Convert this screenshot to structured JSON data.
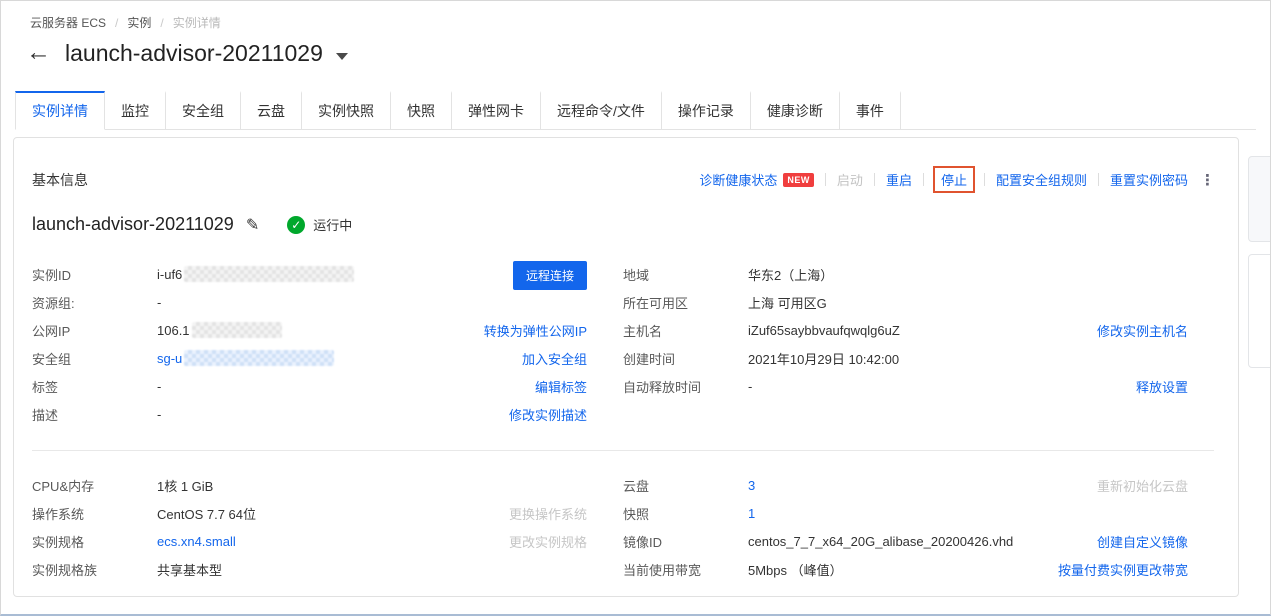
{
  "breadcrumb": {
    "items": [
      "云服务器 ECS",
      "实例",
      "实例详情"
    ],
    "separator": "/"
  },
  "header": {
    "back_icon": "←",
    "title": "launch-advisor-20211029"
  },
  "tabs": [
    {
      "label": "实例详情",
      "active": true
    },
    {
      "label": "监控"
    },
    {
      "label": "安全组"
    },
    {
      "label": "云盘"
    },
    {
      "label": "实例快照"
    },
    {
      "label": "快照"
    },
    {
      "label": "弹性网卡"
    },
    {
      "label": "远程命令/文件"
    },
    {
      "label": "操作记录"
    },
    {
      "label": "健康诊断"
    },
    {
      "label": "事件"
    }
  ],
  "basic": {
    "section_title": "基本信息",
    "actions": {
      "diagnose": "诊断健康状态",
      "new_badge": "NEW",
      "start": "启动",
      "restart": "重启",
      "stop": "停止",
      "configure_sg": "配置安全组规则",
      "reset_password": "重置实例密码",
      "more_icon": "⋮"
    },
    "instance_name": "launch-advisor-20211029",
    "status": "运行中"
  },
  "icons": {
    "edit": "✎",
    "check": "✓"
  },
  "info": {
    "instance_id": {
      "label": "实例ID",
      "value": "i-uf6"
    },
    "remote_connect": "远程连接",
    "resource_group": {
      "label": "资源组:",
      "value": "-"
    },
    "public_ip": {
      "label": "公网IP",
      "value": "106.1",
      "action": "转换为弹性公网IP"
    },
    "security_group": {
      "label": "安全组",
      "value": "sg-u",
      "action": "加入安全组"
    },
    "tags": {
      "label": "标签",
      "value": "-",
      "action": "编辑标签"
    },
    "description": {
      "label": "描述",
      "value": "-",
      "action": "修改实例描述"
    },
    "region": {
      "label": "地域",
      "value": "华东2（上海）"
    },
    "zone": {
      "label": "所在可用区",
      "value": "上海 可用区G"
    },
    "hostname": {
      "label": "主机名",
      "value": "iZuf65saybbvaufqwqlg6uZ",
      "action": "修改实例主机名"
    },
    "created": {
      "label": "创建时间",
      "value": "2021年10月29日 10:42:00"
    },
    "auto_release": {
      "label": "自动释放时间",
      "value": "-",
      "action": "释放设置"
    }
  },
  "config": {
    "cpu_mem": {
      "label": "CPU&内存",
      "value": "1核 1 GiB"
    },
    "os": {
      "label": "操作系统",
      "value": "CentOS 7.7 64位",
      "action": "更换操作系统"
    },
    "instance_type": {
      "label": "实例规格",
      "value": "ecs.xn4.small",
      "action": "更改实例规格"
    },
    "type_family": {
      "label": "实例规格族",
      "value": "共享基本型"
    },
    "disks": {
      "label": "云盘",
      "value": "3",
      "action": "重新初始化云盘"
    },
    "snapshots": {
      "label": "快照",
      "value": "1"
    },
    "image_id": {
      "label": "镜像ID",
      "value": "centos_7_7_x64_20G_alibase_20200426.vhd",
      "action": "创建自定义镜像"
    },
    "bandwidth": {
      "label": "当前使用带宽",
      "value": "5Mbps （峰值）",
      "action": "按量付费实例更改带宽"
    }
  },
  "colors": {
    "accent_blue": "#1366ec",
    "status_green": "#00a82c",
    "new_badge_red": "#f03e3e",
    "stop_highlight_red": "#e0532f"
  }
}
